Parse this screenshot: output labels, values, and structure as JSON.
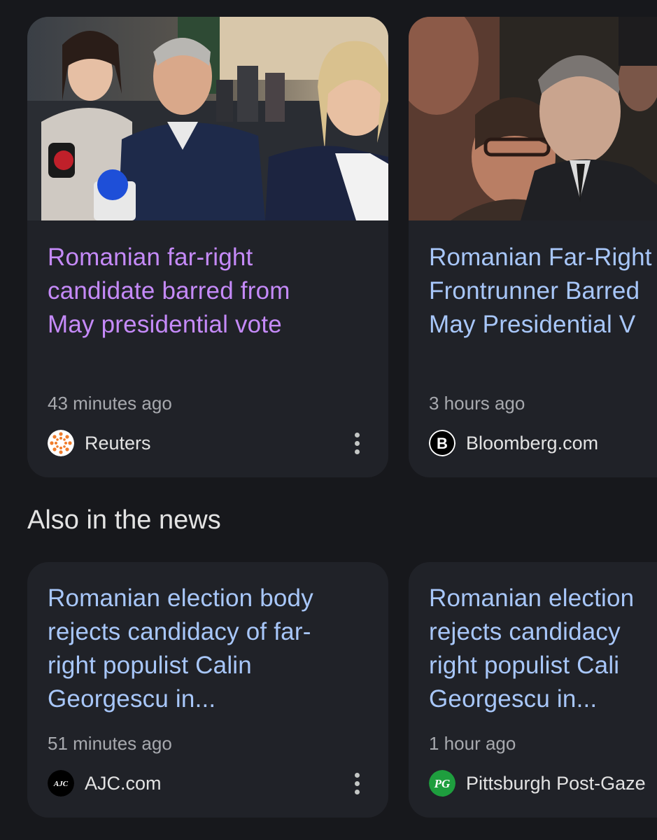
{
  "top_stories": [
    {
      "headline_lines": [
        "Romanian far-right",
        "candidate barred from",
        "May presidential vote"
      ],
      "time": "43 minutes ago",
      "source": "Reuters",
      "logo_icon": "reuters-logo-icon",
      "visited": true
    },
    {
      "headline_lines": [
        "Romanian Far-Right",
        "Frontrunner Barred",
        "May Presidential V"
      ],
      "time": "3 hours ago",
      "source": "Bloomberg.com",
      "logo_icon": "bloomberg-logo-icon",
      "visited": false
    }
  ],
  "section": {
    "title": "Also in the news"
  },
  "also_in_news": [
    {
      "headline_lines": [
        "Romanian election body",
        "rejects candidacy of far-",
        "right populist Calin",
        "Georgescu in..."
      ],
      "time": "51 minutes ago",
      "source": "AJC.com",
      "logo_icon": "ajc-logo-icon"
    },
    {
      "headline_lines": [
        "Romanian election",
        "rejects candidacy",
        "right populist Cali",
        "Georgescu in..."
      ],
      "time": "1 hour ago",
      "source": "Pittsburgh Post-Gaze",
      "logo_icon": "post-gazette-logo-icon"
    }
  ],
  "logo_text": {
    "bloomberg": "B",
    "ajc": "AJC",
    "post_gazette": "PG"
  },
  "colors": {
    "background": "#17181c",
    "card": "#202228",
    "visited_link": "#c58af9",
    "link": "#a8c7fa",
    "meta_text": "#a7a9ae"
  }
}
